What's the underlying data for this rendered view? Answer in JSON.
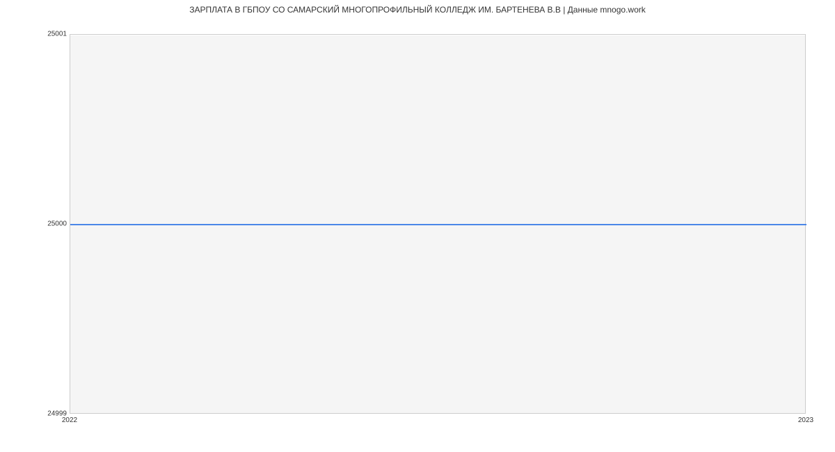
{
  "chart_data": {
    "type": "line",
    "title": "ЗАРПЛАТА В ГБПОУ СО САМАРСКИЙ МНОГОПРОФИЛЬНЫЙ КОЛЛЕДЖ ИМ. БАРТЕНЕВА В.В | Данные mnogo.work",
    "xlabel": "",
    "ylabel": "",
    "x": [
      "2022",
      "2023"
    ],
    "values": [
      25000,
      25000
    ],
    "y_ticks": [
      "24999",
      "25000",
      "25001"
    ],
    "x_ticks": [
      "2022",
      "2023"
    ],
    "ylim": [
      24999,
      25001
    ],
    "line_color": "#4a86e8",
    "grid": true
  }
}
